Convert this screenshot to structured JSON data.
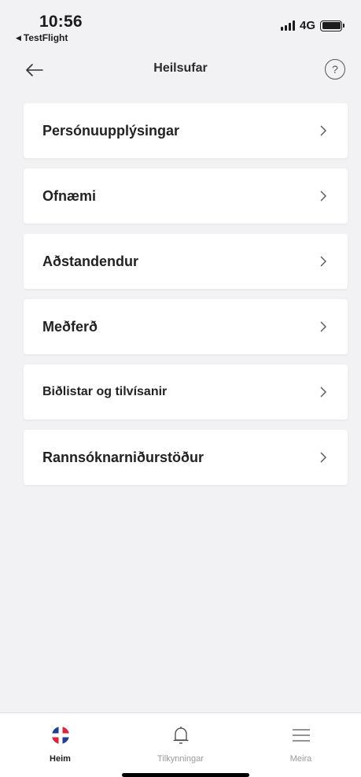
{
  "status_bar": {
    "time": "10:56",
    "back_app": "TestFlight",
    "network": "4G"
  },
  "nav": {
    "title": "Heilsufar",
    "help_symbol": "?"
  },
  "menu": {
    "items": [
      {
        "label": "Persónuupplýsingar"
      },
      {
        "label": "Ofnæmi"
      },
      {
        "label": "Aðstandendur"
      },
      {
        "label": "Meðferð"
      },
      {
        "label": "Biðlistar og tilvísanir"
      },
      {
        "label": "Rannsóknarniðurstöður"
      }
    ]
  },
  "tab_bar": {
    "tabs": [
      {
        "label": "Heim",
        "icon": "home-logo-icon",
        "active": true
      },
      {
        "label": "Tilkynningar",
        "icon": "bell-icon",
        "active": false
      },
      {
        "label": "Meira",
        "icon": "hamburger-menu-icon",
        "active": false
      }
    ]
  },
  "colors": {
    "background": "#f2f2f4",
    "card": "#ffffff",
    "brand_red": "#d7263d",
    "brand_blue": "#1f3e91"
  }
}
